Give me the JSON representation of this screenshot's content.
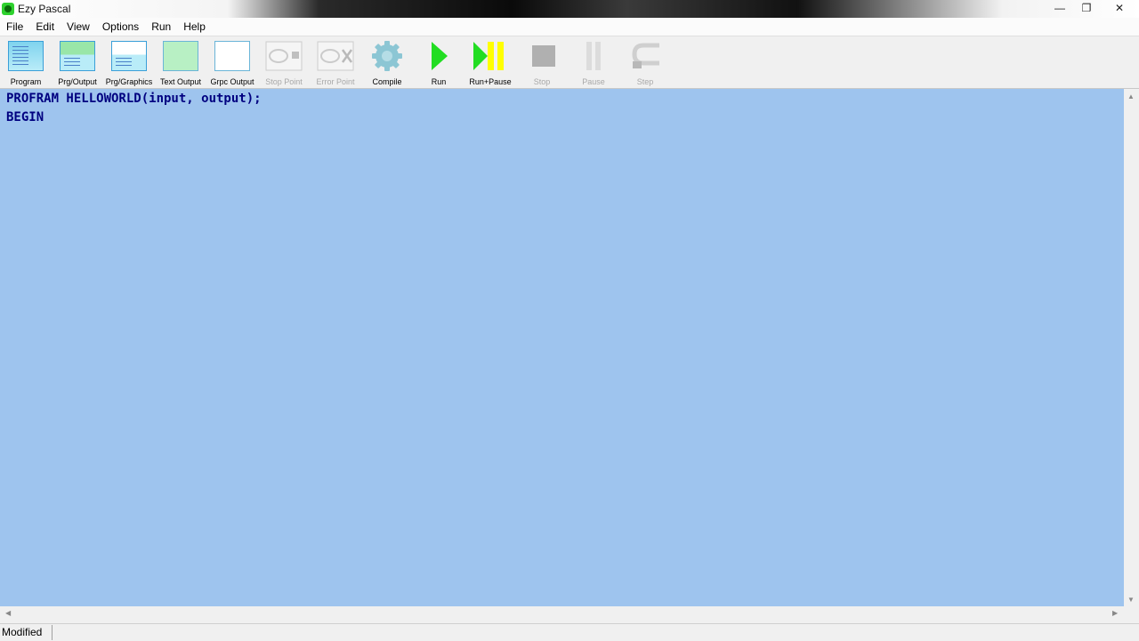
{
  "window": {
    "title": "Ezy Pascal"
  },
  "menu": [
    "File",
    "Edit",
    "View",
    "Options",
    "Run",
    "Help"
  ],
  "toolbar": {
    "program": "Program",
    "prg_output": "Prg/Output",
    "prg_graphics": "Prg/Graphics",
    "text_output": "Text Output",
    "grpc_output": "Grpc Output",
    "stop_point": "Stop Point",
    "error_point": "Error Point",
    "compile": "Compile",
    "run": "Run",
    "run_pause": "Run+Pause",
    "stop": "Stop",
    "pause": "Pause",
    "step": "Step"
  },
  "editor": {
    "lines": [
      "PROFRAM HELLOWORLD(input, output);",
      "BEGIN"
    ]
  },
  "status": {
    "state": "Modified"
  },
  "colors": {
    "editor_bg": "#9ec4ee",
    "code_text": "#000080",
    "run_green": "#22dd22",
    "pause_yellow": "#ffff00"
  }
}
